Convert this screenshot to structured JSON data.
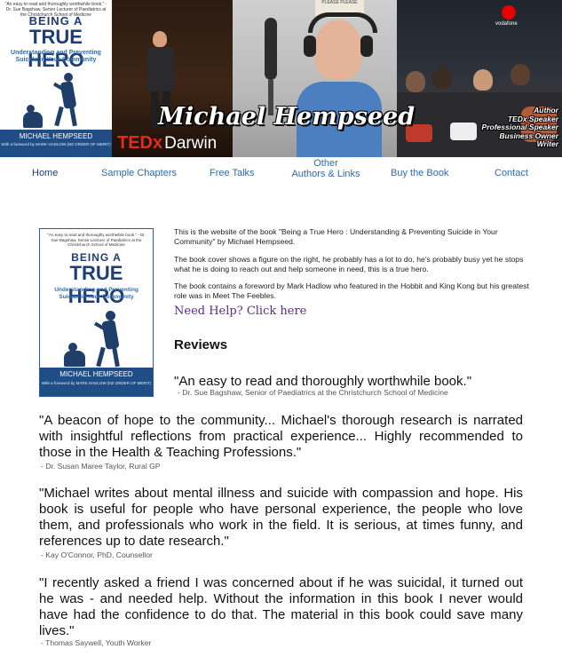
{
  "banner": {
    "name": "Michael Hempseed",
    "roles": [
      "Author",
      "TEDx Speaker",
      "Professional Speaker",
      "Business Owner",
      "Writer"
    ],
    "ted_logo": "TEDx",
    "ted_city": "Darwin",
    "vodafone": "vodafone"
  },
  "cover": {
    "quote": "\"An easy to read and thoroughly worthwhile book.\" - Dr. Sue Bagshaw, Senior Lecturer of Paediatrics at the Christchurch School of Medicine",
    "title_line1": "BEING A",
    "title_line2": "TRUE HERO",
    "subtitle": "Understanding and Preventing Suicide in Your Community",
    "author": "MICHAEL HEMPSEED",
    "foreword": "With a foreword by MARK HADLOW (NZ ORDER OF MERIT)"
  },
  "nav": {
    "home": "Home",
    "sample": "Sample Chapters",
    "talks": "Free Talks",
    "other1": "Other",
    "other2": "Authors & Links",
    "buy": "Buy the Book",
    "contact": "Contact"
  },
  "intro": {
    "p1": "This is the website of the book \"Being a True Hero : Understanding & Preventing Suicide in Your Community\" by Michael Hempseed.",
    "p2": "The book cover shows a figure on the right, he probably has a lot to do, he's probably busy yet he stops what he is doing to reach out and help someone in need, this is a true hero.",
    "p3": "The book contains a foreword by Mark Hadlow who featured in the Hobbit and King Kong but his greatest role was in Meet The Feebles."
  },
  "help_link": "Need Help? Click here",
  "reviews_heading": "Reviews",
  "reviews": [
    {
      "quote": "\"An easy to read and thoroughly worthwhile book.\"",
      "attr": "- Dr. Sue Bagshaw, Senior of Paediatrics at the Christchurch School of Medicine"
    },
    {
      "quote": "\"A beacon of hope to the community... Michael's thorough research is narrated with insightful reflections from practical experience... Highly recommended to those in the Health & Teaching Professions.\"",
      "attr": "- Dr. Susan Maree Taylor, Rural GP"
    },
    {
      "quote": "\"Michael writes about mental illness and suicide with compassion and hope. His book is useful for people who have personal experience, the people who love them, and professionals who work in the field. It is serious, at times funny, and references up to date research.\"",
      "attr": "- Kay O'Connor, PhD, Counsellor"
    },
    {
      "quote": "\"I recently asked a friend I was concerned about if he was suicidal, it turned out he was - and needed help. Without the information in this book I never would have had the confidence to do that. The material in this book could save many lives.\"",
      "attr": "- Thomas Saywell, Youth Worker"
    }
  ]
}
